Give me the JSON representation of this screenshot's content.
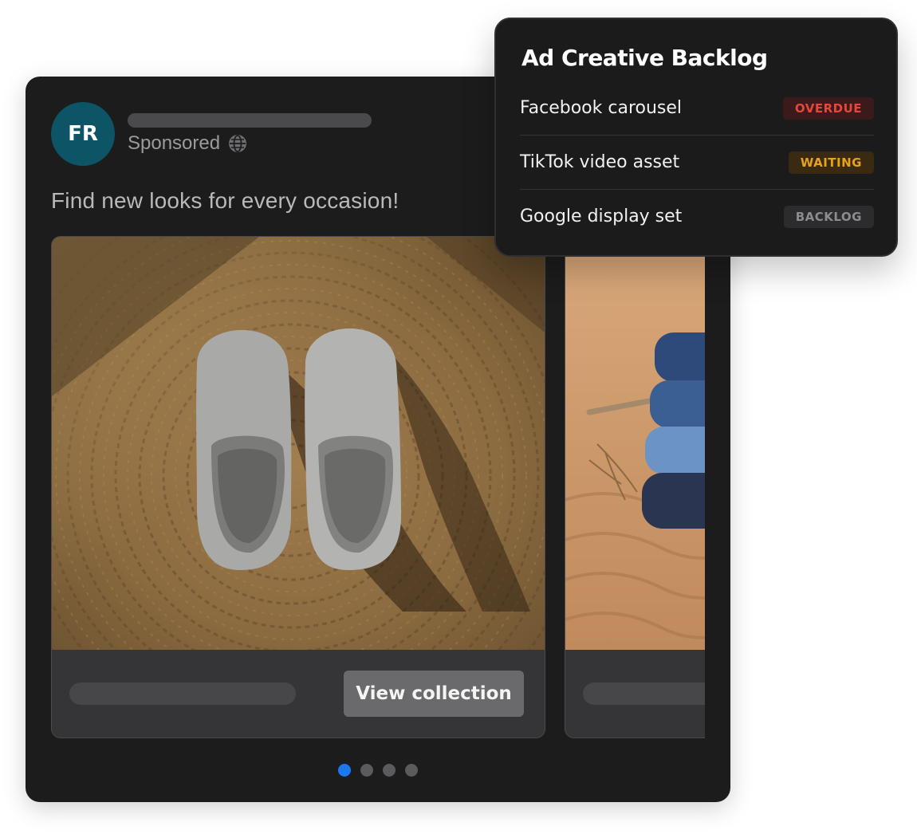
{
  "ad": {
    "avatar_initials": "FR",
    "sponsored_label": "Sponsored",
    "caption": "Find new looks for every occasion!",
    "slides": [
      {
        "photo_icon": "slippers-photo",
        "cta_label": "View collection"
      },
      {
        "photo_icon": "jeans-photo"
      }
    ],
    "pagination": {
      "total": 4,
      "active": 1
    }
  },
  "backlog": {
    "title": "Ad Creative Backlog",
    "items": [
      {
        "label": "Facebook carousel",
        "status": "OVERDUE"
      },
      {
        "label": "TikTok video asset",
        "status": "WAITING"
      },
      {
        "label": "Google display set",
        "status": "BACKLOG"
      }
    ]
  },
  "colors": {
    "card_bg": "#1c1c1d",
    "avatar_bg": "#0d5466",
    "pagination_active": "#1b78f2",
    "status_overdue": "#e8453b",
    "status_waiting": "#e8a21c",
    "status_backlog": "#8c8c90"
  }
}
